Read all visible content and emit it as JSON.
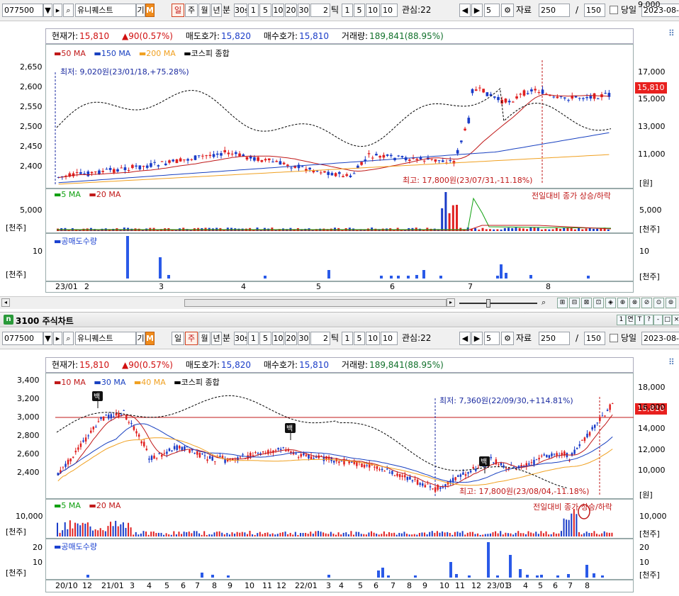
{
  "toolbar": {
    "code": "077500",
    "name": "유니퀘스트",
    "gi": "기",
    "m": "M",
    "periods": [
      "일",
      "주",
      "월",
      "년",
      "분",
      "30s",
      "1",
      "5",
      "10",
      "20",
      "30"
    ],
    "tick_value": "2",
    "tick_label": "틱",
    "tick_options": [
      "1",
      "5",
      "10"
    ],
    "tick_current": "10",
    "watch": "관심:22",
    "page": "5",
    "data_label": "자료",
    "data_count": "250",
    "slash": "/",
    "total": "150",
    "sameday": "당일",
    "date": "2023-08-"
  },
  "info": {
    "price_label": "현재가:",
    "price": "15,810",
    "change": "▲90(0.57%)",
    "ask_label": "매도호가:",
    "ask": "15,820",
    "bid_label": "매수호가:",
    "bid": "15,810",
    "vol_label": "거래량:",
    "vol": "189,841(88.95%)"
  },
  "top": {
    "legend": [
      "50 MA",
      "150 MA",
      "200 MA",
      "코스피 종합"
    ],
    "low_note": "최저: 9,020원(23/01/18,+75.28%)",
    "high_note": "최고: 17,800원(23/07/31,-11.18%)",
    "price_tag": "15,810",
    "left_axis": [
      "2,650",
      "2,600",
      "2,550",
      "2,500",
      "2,450",
      "2,400"
    ],
    "right_axis": [
      "17,000",
      "15,000",
      "13,000",
      "11,000",
      "9,000"
    ],
    "unit_won": "[원]",
    "vol_legend": [
      "5 MA",
      "20 MA"
    ],
    "vol_note": "전일대비 종가 상승/하락",
    "vol_left": "5,000",
    "vol_right": "5,000",
    "unit_thousand": "[천주]",
    "short_legend": "공매도수량",
    "short_left": "10",
    "short_right": "10",
    "months": [
      "23/01",
      "2",
      "3",
      "4",
      "5",
      "6",
      "7",
      "8"
    ]
  },
  "window2": {
    "title": "3100 주식차트",
    "icons": [
      "1",
      "연",
      "T",
      "?",
      "-",
      "□",
      "×"
    ]
  },
  "bottom": {
    "legend": [
      "10 MA",
      "30 MA",
      "40 MA",
      "코스피 종합"
    ],
    "low_note": "최저: 7,360원(22/09/30,+114.81%)",
    "high_note": "최고: 17,800원(23/08/04,-11.18%)",
    "price_tag": "15,810",
    "left_axis": [
      "3,400",
      "3,200",
      "3,000",
      "2,800",
      "2,600",
      "2,400"
    ],
    "right_axis": [
      "18,000",
      "16,000",
      "14,000",
      "12,000",
      "10,000"
    ],
    "unit_won": "[원]",
    "vol_legend": [
      "5 MA",
      "20 MA"
    ],
    "vol_note": "전일대비 종가 상승/하락",
    "vol_left": "10,000",
    "vol_right": "10,000",
    "unit_thousand": "[천주]",
    "short_legend": "공매도수량",
    "short_left": [
      "20",
      "10"
    ],
    "short_right": [
      "20",
      "10"
    ],
    "months": [
      "20/10",
      "12",
      "21/01",
      "3",
      "4",
      "5",
      "6",
      "7",
      "8",
      "9",
      "10",
      "11",
      "12",
      "22/01",
      "3",
      "4",
      "5",
      "6",
      "7",
      "8",
      "9",
      "10",
      "11",
      "12",
      "23/01",
      "3",
      "4",
      "5",
      "6",
      "7",
      "8"
    ],
    "signal": "백"
  },
  "colors": {
    "up": "#e02020",
    "down": "#1a3cc8",
    "ma_red": "#c01818",
    "ma_blue": "#1840c0",
    "ma_orange": "#f0a020",
    "kospi": "#000000",
    "vol_green": "#10a010"
  }
}
